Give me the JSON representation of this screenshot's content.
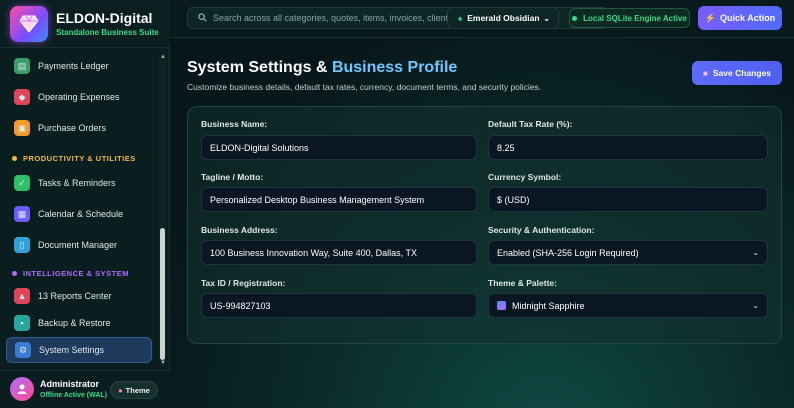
{
  "brand": {
    "title": "ELDON-Digital",
    "subtitle": "Standalone Business Suite"
  },
  "sidebar": {
    "items": [
      {
        "label": "Payments Ledger",
        "icon": "ledger-icon",
        "color": "#3a9e6a"
      },
      {
        "label": "Operating Expenses",
        "icon": "expenses-icon",
        "color": "#e0445a"
      },
      {
        "label": "Purchase Orders",
        "icon": "purchase-order-icon",
        "color": "#f09a2c"
      },
      {
        "label": "Tasks & Reminders",
        "icon": "checkbox-icon",
        "color": "#2fbf6a"
      },
      {
        "label": "Calendar & Schedule",
        "icon": "calendar-icon",
        "color": "#6a5cff"
      },
      {
        "label": "Document Manager",
        "icon": "document-icon",
        "color": "#2fa3d8"
      },
      {
        "label": "13 Reports Center",
        "icon": "chart-icon",
        "color": "#e0445a"
      },
      {
        "label": "Backup & Restore",
        "icon": "floppy-disk-icon",
        "color": "#2aa6a0"
      },
      {
        "label": "System Settings",
        "icon": "gear-icon",
        "color": "#3a7bd5",
        "active": true
      }
    ],
    "sections": [
      {
        "label": "PRODUCTIVITY & UTILITIES",
        "color": "#f2b84b"
      },
      {
        "label": "INTELLIGENCE & SYSTEM",
        "color": "#b06bff"
      }
    ]
  },
  "user": {
    "name": "Administrator",
    "status": "Offline Active (WAL)",
    "theme_label": "Theme"
  },
  "topbar": {
    "search_placeholder": "Search across all categories, quotes, items, invoices, clients...",
    "theme_select": "Emerald Obsidian",
    "engine_status": "Local SQLite Engine Active",
    "quick_action": "Quick Action"
  },
  "page": {
    "title_main": "System Settings & ",
    "title_accent": "Business Profile",
    "subtitle": "Customize business details, default tax rates, currency, document terms, and security policies.",
    "save_label": "Save Changes"
  },
  "form": {
    "business_name": {
      "label": "Business Name:",
      "value": "ELDON-Digital Solutions"
    },
    "tax_rate": {
      "label": "Default Tax Rate (%):",
      "value": "8.25"
    },
    "tagline": {
      "label": "Tagline / Motto:",
      "value": "Personalized Desktop Business Management System"
    },
    "currency": {
      "label": "Currency Symbol:",
      "value": "$ (USD)"
    },
    "address": {
      "label": "Business Address:",
      "value": "100 Business Innovation Way, Suite 400, Dallas, TX"
    },
    "security": {
      "label": "Security & Authentication:",
      "value": "Enabled (SHA-256 Login Required)"
    },
    "tax_id": {
      "label": "Tax ID / Registration:",
      "value": "US-994827103"
    },
    "palette": {
      "label": "Theme & Palette:",
      "value": "Midnight Sapphire"
    }
  },
  "colors": {
    "accent": "#6fc8ff",
    "success": "#39d98a",
    "primary_button": "#5d6bff"
  }
}
